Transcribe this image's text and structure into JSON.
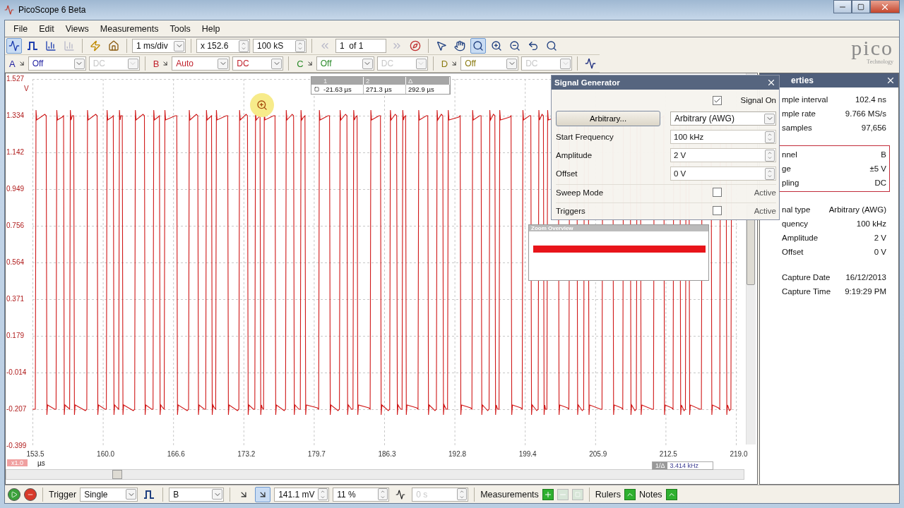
{
  "window": {
    "title": "PicoScope 6 Beta"
  },
  "menu": [
    "File",
    "Edit",
    "Views",
    "Measurements",
    "Tools",
    "Help"
  ],
  "toolbar": {
    "view_modes": [
      {
        "kind": "scope",
        "selected": true
      },
      {
        "kind": "persistence",
        "selected": false
      },
      {
        "kind": "spectrum",
        "selected": false
      }
    ],
    "timebase": "1 ms/div",
    "zoom": "x 152.6",
    "samples": "100 kS",
    "buffer": "1  of 1",
    "tools": [
      {
        "kind": "pointer",
        "selected": false
      },
      {
        "kind": "hand",
        "selected": false
      },
      {
        "kind": "zoom-box",
        "selected": true
      },
      {
        "kind": "zoom-in",
        "selected": false
      },
      {
        "kind": "zoom-out",
        "selected": false
      },
      {
        "kind": "undo",
        "selected": false
      },
      {
        "kind": "zoom-fit",
        "selected": false
      }
    ]
  },
  "logo": {
    "name": "pico",
    "tagline": "Technology"
  },
  "channels": [
    {
      "letter": "A",
      "color": "#1f1fa0",
      "range": "Off",
      "coupling": "DC",
      "coupling_disabled": true
    },
    {
      "letter": "B",
      "color": "#c01f2a",
      "range": "Auto",
      "coupling": "DC",
      "coupling_disabled": false
    },
    {
      "letter": "C",
      "color": "#2a8a2a",
      "range": "Off",
      "coupling": "DC",
      "coupling_disabled": true
    },
    {
      "letter": "D",
      "color": "#8a7a10",
      "range": "Off",
      "coupling": "DC",
      "coupling_disabled": true
    }
  ],
  "scope": {
    "y_unit": "V",
    "y_labels": [
      "1.527",
      "1.334",
      "1.142",
      "0.949",
      "0.756",
      "0.564",
      "0.371",
      "0.179",
      "-0.014",
      "-0.207",
      "-0.399"
    ],
    "x_labels": [
      "153.5",
      "160.0",
      "166.6",
      "173.2",
      "179.7",
      "186.3",
      "192.8",
      "199.4",
      "205.9",
      "212.5",
      "219.0"
    ],
    "x_unit": "µs",
    "x_zoom": "x1.0",
    "rulers": {
      "headers": [
        "1",
        "2",
        "Δ"
      ],
      "values": [
        "-21.63 µs",
        "271.3 µs",
        "292.9 µs"
      ]
    },
    "frequency": {
      "label": "1/Δ",
      "value": "3.414 kHz"
    },
    "zoom_overview": {
      "title": "Zoom Overview"
    }
  },
  "signal_generator": {
    "title": "Signal Generator",
    "signal_on": {
      "label": "Signal On",
      "checked": true
    },
    "button": "Arbitrary...",
    "signal_type": "Arbitrary (AWG)",
    "fields": [
      {
        "label": "Start Frequency",
        "value": "100 kHz"
      },
      {
        "label": "Amplitude",
        "value": "2 V"
      },
      {
        "label": "Offset",
        "value": "0 V"
      }
    ],
    "options": [
      {
        "label": "Sweep Mode",
        "checked": false,
        "state_label": "Active"
      },
      {
        "label": "Triggers",
        "checked": false,
        "state_label": "Active"
      }
    ]
  },
  "properties": {
    "title": "erties",
    "groups": [
      {
        "boxed": false,
        "rows": [
          {
            "label": "mple interval",
            "value": "102.4 ns"
          },
          {
            "label": "mple rate",
            "value": "9.766 MS/s"
          },
          {
            "label": "samples",
            "value": "97,656"
          }
        ]
      },
      {
        "boxed": true,
        "rows": [
          {
            "label": "nnel",
            "value": "B"
          },
          {
            "label": "ge",
            "value": "±5 V"
          },
          {
            "label": "pling",
            "value": "DC"
          }
        ]
      },
      {
        "boxed": false,
        "rows": [
          {
            "label": "nal type",
            "value": "Arbitrary (AWG)"
          },
          {
            "label": "quency",
            "value": "100 kHz"
          },
          {
            "label": "Amplitude",
            "value": "2 V"
          },
          {
            "label": "Offset",
            "value": "0 V"
          }
        ]
      },
      {
        "boxed": false,
        "rows": [
          {
            "label": "Capture Date",
            "value": "16/12/2013"
          },
          {
            "label": "Capture Time",
            "value": "9:19:29 PM"
          }
        ]
      }
    ]
  },
  "status_bar": {
    "trigger_label": "Trigger",
    "trigger_mode": "Single",
    "trigger_source": "B",
    "threshold": "141.1 mV",
    "pre_trigger": "11 %",
    "delay": "0 s",
    "measurements": "Measurements",
    "rulers": "Rulers",
    "notes": "Notes"
  }
}
